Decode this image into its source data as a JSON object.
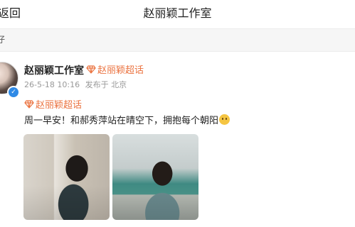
{
  "navbar": {
    "back_label": "返回",
    "title": "赵丽颖工作室"
  },
  "subbar": {
    "text": "仔"
  },
  "post": {
    "author": "赵丽颖工作室",
    "author_topic": "赵丽颖超话",
    "timestamp": "26-5-18 10:16",
    "source": "发布于 北京",
    "topic_tag": "赵丽颖超话",
    "text": "周一早安！和郝秀萍站在晴空下，拥抱每个朝阳",
    "emoji": "pensive-face",
    "images": [
      "photo-1",
      "photo-2"
    ]
  },
  "colors": {
    "topic": "#eb7340",
    "verified": "#2f8ae6",
    "meta": "#999999"
  }
}
